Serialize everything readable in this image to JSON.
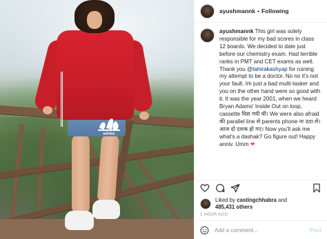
{
  "post": {
    "username": "ayushmannk",
    "follow_separator": "•",
    "follow_label": "Following",
    "caption": {
      "before_mention": "This girl was solely responsible for my bad scores in class 12 boards. We decided to date just before our chemistry exam. Had terrible ranks in PMT and CET exams as well. Thank you ",
      "mention": "@tahirakashyap",
      "after_mention": " for ruining my attempt to be a doctor. No no it's not your fault. Im just a bad multi-tasker and you on the other hand were so good with it. It was the year 2001, when we heard Bryan Adams' Inside Out on loop, cassette घिस गयी थी। We were also afraid की parallel line से parents phone ना उठा लें। आज दो दशक हो गए। Now you'll ask me what's a dashak? Go figure out! Happy anniv. Umm ",
      "emoji": "❤"
    },
    "likes": {
      "prefix": "Liked by ",
      "first_user": "castingchhabra",
      "middle": " and",
      "count": "485,431 others"
    },
    "time_ago": "1 HOUR AGO",
    "comment": {
      "placeholder": "Add a comment...",
      "post_label": "Post"
    }
  },
  "photo": {
    "logo_text": "adidas",
    "jacket_color": "#c81e29"
  },
  "icons": {
    "more": "more-options-icon",
    "emoji": "smiley-emoji-icon",
    "like": "heart-icon",
    "comment": "comment-icon",
    "share": "share-icon",
    "save": "bookmark-icon"
  }
}
